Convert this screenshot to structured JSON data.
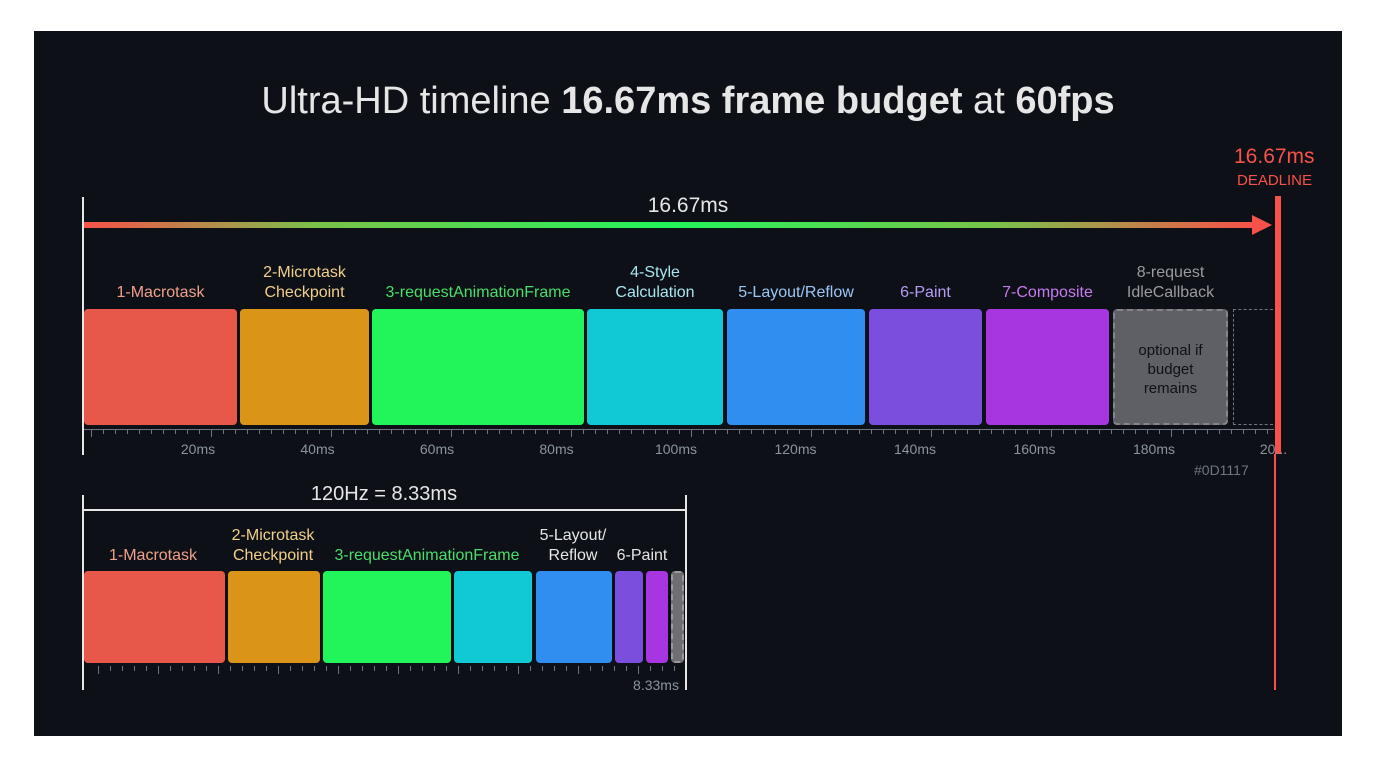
{
  "title": {
    "part1": "Ultra-HD timeline ",
    "bold1": "16.67ms frame budget",
    "part2": " at ",
    "bold2": "60fps"
  },
  "deadline": {
    "value": "16.67ms",
    "label": "DEADLINE",
    "color": "#f85149"
  },
  "frame60": {
    "span_label": "16.67ms",
    "phases": [
      {
        "label_lines": [
          "1-Macrotask"
        ],
        "color": "#e8584a",
        "label_color": "#f0a08a"
      },
      {
        "label_lines": [
          "2-Microtask",
          "Checkpoint"
        ],
        "color": "#da9418",
        "label_color": "#f2cf8a"
      },
      {
        "label_lines": [
          "3-requestAnimationFrame"
        ],
        "color": "#22f55a",
        "label_color": "#4ade6a"
      },
      {
        "label_lines": [
          "4-Style",
          "Calculation"
        ],
        "color": "#11c9d4",
        "label_color": "#a8e6ef"
      },
      {
        "label_lines": [
          "5-Layout/Reflow"
        ],
        "color": "#2f8ef0",
        "label_color": "#9cc7f5"
      },
      {
        "label_lines": [
          "6-Paint"
        ],
        "color": "#7b4ede",
        "label_color": "#b69cf5"
      },
      {
        "label_lines": [
          "7-Composite"
        ],
        "color": "#a735e0",
        "label_color": "#c77af0"
      },
      {
        "label_lines": [
          "8-request",
          "IdleCallback"
        ],
        "color": "#6e6e73",
        "label_color": "#9a9a9f",
        "note_lines": [
          "optional if",
          "budget",
          "remains"
        ]
      }
    ],
    "axis_labels": [
      "20ms",
      "40ms",
      "60ms",
      "80ms",
      "100ms",
      "120ms",
      "140ms",
      "160ms",
      "180ms",
      "20..."
    ],
    "hex_note": "#0D1117"
  },
  "frame120": {
    "span_label": "120Hz = 8.33ms",
    "phases": [
      {
        "label_lines": [
          "1-Macrotask"
        ],
        "color": "#e8584a",
        "label_color": "#f0a08a"
      },
      {
        "label_lines": [
          "2-Microtask",
          "Checkpoint"
        ],
        "color": "#da9418",
        "label_color": "#f2cf8a"
      },
      {
        "label_lines": [
          "3-requestAnimationFrame"
        ],
        "color": "#22f55a",
        "label_color": "#4ade6a"
      },
      {
        "label_lines": [],
        "color": "#11c9d4",
        "label_color": "#a8e6ef"
      },
      {
        "label_lines": [
          "5-Layout/",
          "Reflow"
        ],
        "color": "#2f8ef0",
        "label_color": "#e6e6e6"
      },
      {
        "label_lines": [
          "6-Paint"
        ],
        "color": "#7b4ede",
        "label_color": "#e6e6e6"
      },
      {
        "label_lines": [],
        "color": "#a735e0",
        "label_color": "#c77af0"
      },
      {
        "label_lines": [],
        "color": "#6e6e73",
        "label_color": "#9a9a9f"
      }
    ],
    "axis_end_label": "8.33ms"
  }
}
